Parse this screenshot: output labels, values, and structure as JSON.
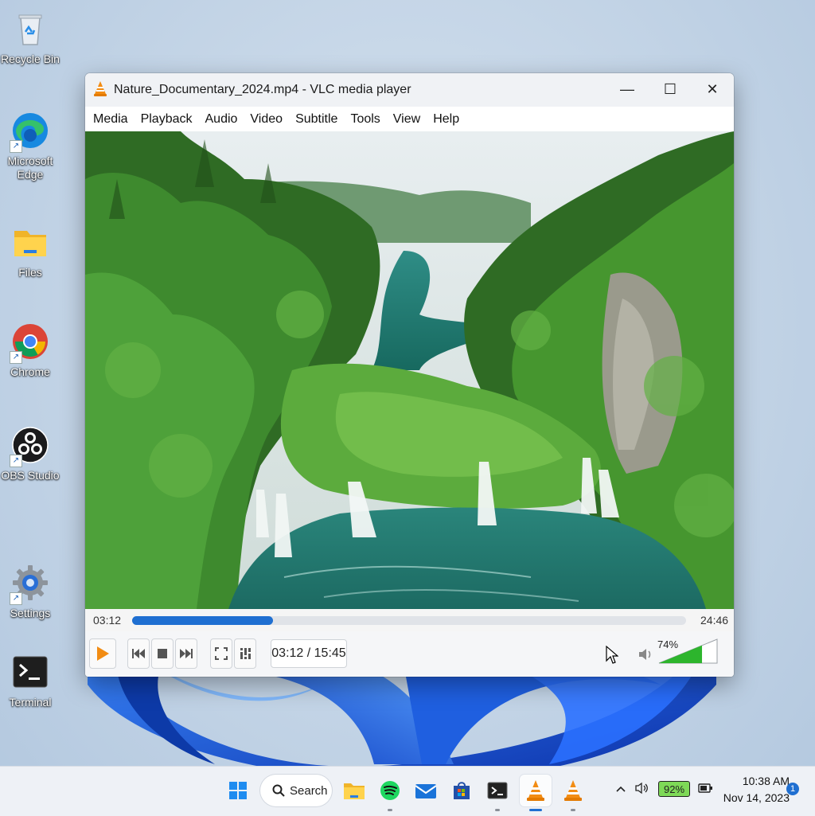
{
  "desktop": {
    "icons": [
      {
        "label": "Recycle Bin",
        "icon": "recycle-bin-icon"
      },
      {
        "label": "Microsoft Edge",
        "icon": "edge-icon"
      },
      {
        "label": "Files",
        "icon": "folder-icon"
      },
      {
        "label": "Chrome",
        "icon": "chrome-icon"
      },
      {
        "label": "OBS Studio",
        "icon": "obs-icon"
      },
      {
        "label": "Settings",
        "icon": "gear-icon"
      },
      {
        "label": "Terminal",
        "icon": "terminal-icon"
      }
    ]
  },
  "window": {
    "title": "Nature_Documentary_2024.mp4 - VLC media player",
    "controls": {
      "minimize": "—",
      "maximize": "☐",
      "close": "✕"
    },
    "menu": [
      "Media",
      "Playback",
      "Audio",
      "Video",
      "Subtitle",
      "Tools",
      "View",
      "Help"
    ]
  },
  "player": {
    "elapsed": "03:12",
    "remaining": "24:46",
    "time_display": "03:12 / 15:45",
    "progress": 0.254,
    "volume": {
      "label": "74%",
      "level": 0.74
    },
    "accent": "#f28c13",
    "seek_color": "#1f6fd1",
    "volume_color": "#2db52d"
  },
  "taskbar": {
    "search_label": "Search",
    "apps": [
      "start-icon",
      "file-explorer-icon",
      "spotify-icon",
      "mail-icon",
      "store-icon",
      "terminal-icon",
      "vlc-icon",
      "vlc-icon"
    ],
    "battery": "92%",
    "time": "10:38 AM",
    "date": "Nov 14, 2023",
    "notification_count": "1"
  }
}
